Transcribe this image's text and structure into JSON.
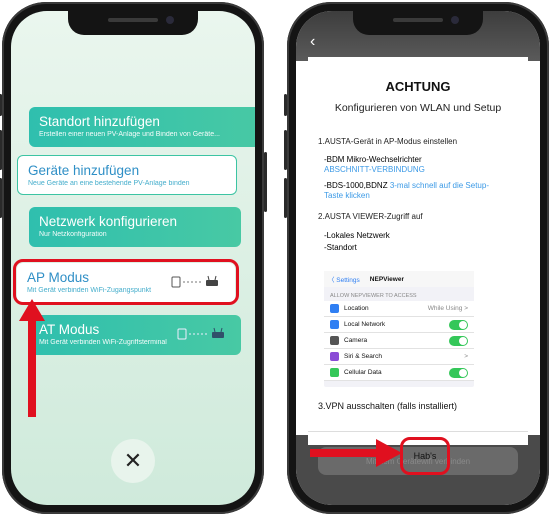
{
  "left": {
    "cards": [
      {
        "title": "Standort hinzufügen",
        "sub": "Erstellen einer neuen PV-Anlage und Binden von Geräte..."
      },
      {
        "title": "Geräte hinzufügen",
        "sub": "Neue Geräte an eine bestehende PV-Anlage binden"
      },
      {
        "title": "Netzwerk konfigurieren",
        "sub": "Nur Netzkonfiguration"
      },
      {
        "title": "AP Modus",
        "sub": "Mit Gerät verbinden WiFi-Zugangspunkt"
      },
      {
        "title": "AT Modus",
        "sub": "Mit Gerät verbinden WiFi-Zugriffsterminal"
      }
    ],
    "close_symbol": "✕"
  },
  "right": {
    "title": "ACHTUNG",
    "subtitle": "Konfigurieren von WLAN und Setup",
    "step1": "1.AUSTA-Gerät in AP-Modus einstellen",
    "bdm": "-BDM Mikro-Wechselrichter",
    "bdm_link": "ABSCHNITT-VERBINDUNG",
    "bds": "-BDS-1000,BDNZ",
    "bds_link": "3-mal schnell auf die Setup-",
    "bds_link2": "Taste klicken",
    "step2": "2.AUSTA VIEWER-Zugriff auf",
    "local": "-Lokales Netzwerk",
    "location": "-Standort",
    "ios": {
      "back": "〈 Settings",
      "app": "NEPViewer",
      "caption": "ALLOW NEPVIEWER TO ACCESS",
      "rows": [
        {
          "label": "Location",
          "value": "While Using >",
          "color": "#2f7ff3"
        },
        {
          "label": "Local Network",
          "value": "",
          "color": "#2f7ff3"
        },
        {
          "label": "Camera",
          "value": "",
          "color": "#555555"
        },
        {
          "label": "Siri & Search",
          "value": ">",
          "color": "#8a4bd6"
        },
        {
          "label": "Cellular Data",
          "value": "",
          "color": "#34c759"
        }
      ]
    },
    "step3": "3.VPN ausschalten (falls installiert)",
    "ok": "Hab's",
    "ghost": "Mit dem Gerätewifi verbinden"
  },
  "colors": {
    "accent_red": "#e0101f",
    "teal": "#2fbfae",
    "ios_green": "#34c759"
  }
}
